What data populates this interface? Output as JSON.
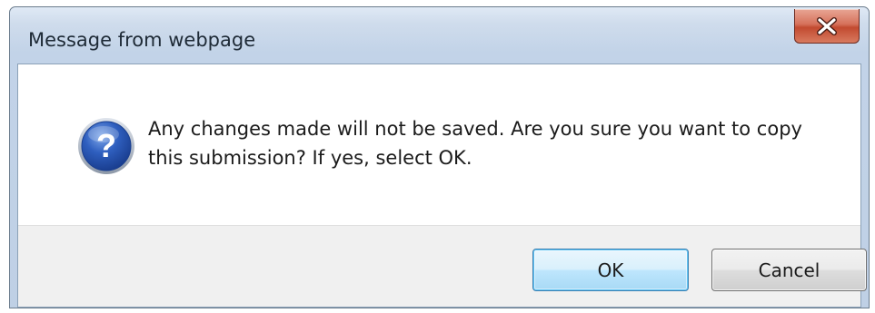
{
  "dialog": {
    "title": "Message from webpage",
    "message": "Any changes made will not be saved.  Are you sure you want to copy\nthis submission? If yes, select OK.",
    "icon": "question-icon",
    "close_icon": "close-icon"
  },
  "buttons": {
    "ok_label": "OK",
    "cancel_label": "Cancel"
  },
  "colors": {
    "titlebar": "#c7d7ea",
    "close_button": "#c9533b",
    "ok_border": "#3c7fb1",
    "footer": "#f0f0f0",
    "icon_blue": "#2a58b8"
  }
}
